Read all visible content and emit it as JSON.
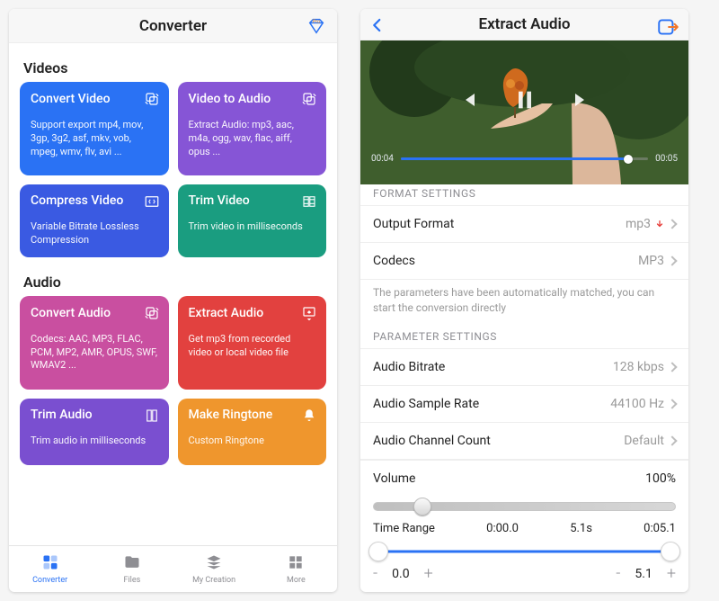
{
  "left": {
    "title": "Converter",
    "sections": [
      {
        "title": "Videos",
        "cards": [
          {
            "title": "Convert Video",
            "desc": "Support export mp4, mov, 3gp, 3g2, asf, mkv, vob, mpeg, wmv, flv, avi ...",
            "color": "#2a72f4",
            "icon": "convert",
            "size": "lg"
          },
          {
            "title": "Video to Audio",
            "desc": "Extract Audio: mp3, aac, m4a, ogg, wav, flac, aiff, opus ...",
            "color": "#8655d6",
            "icon": "convert",
            "size": "lg"
          },
          {
            "title": "Compress Video",
            "desc": "Variable Bitrate Lossless Compression",
            "color": "#3a5ae2",
            "icon": "compress",
            "size": "md"
          },
          {
            "title": "Trim Video",
            "desc": "Trim video in milliseconds",
            "color": "#1a9d80",
            "icon": "trim",
            "size": "md"
          }
        ]
      },
      {
        "title": "Audio",
        "cards": [
          {
            "title": "Convert Audio",
            "desc": "Codecs: AAC, MP3, FLAC, PCM, MP2, AMR, OPUS, SWF, WMAV2 ...",
            "color": "#c94fa0",
            "icon": "convert",
            "size": "lg"
          },
          {
            "title": "Extract Audio",
            "desc": "Get mp3 from recorded video or local video file",
            "color": "#e2413f",
            "icon": "extract",
            "size": "lg"
          },
          {
            "title": "Trim Audio",
            "desc": "Trim audio in milliseconds",
            "color": "#7a4fd0",
            "icon": "book",
            "size": "md"
          },
          {
            "title": "Make Ringtone",
            "desc": "Custom Ringtone",
            "color": "#ef962d",
            "icon": "bell",
            "size": "md"
          }
        ]
      }
    ],
    "tabs": [
      {
        "label": "Converter",
        "active": true
      },
      {
        "label": "Files",
        "active": false
      },
      {
        "label": "My Creation",
        "active": false
      },
      {
        "label": "More",
        "active": false
      }
    ]
  },
  "right": {
    "title": "Extract Audio",
    "video": {
      "current": "00:04",
      "total": "00:05",
      "progress_pct": 92
    },
    "format_header": "FORMAT SETTINGS",
    "rows_format": [
      {
        "label": "Output Format",
        "value": "mp3",
        "red": true
      },
      {
        "label": "Codecs",
        "value": "MP3",
        "red": false
      }
    ],
    "hint": "The parameters have been automatically matched, you can start the conversion directly",
    "param_header": "PARAMETER SETTINGS",
    "rows_param": [
      {
        "label": "Audio Bitrate",
        "value": "128 kbps"
      },
      {
        "label": "Audio Sample Rate",
        "value": "44100 Hz"
      },
      {
        "label": "Audio Channel Count",
        "value": "Default"
      }
    ],
    "volume": {
      "label": "Volume",
      "value": "100%",
      "thumb_pct": 16
    },
    "time_range": {
      "label": "Time Range",
      "start": "0:00.0",
      "mid": "5.1s",
      "end": "0:05.1",
      "v0": "0.0",
      "v1": "5.1"
    }
  }
}
